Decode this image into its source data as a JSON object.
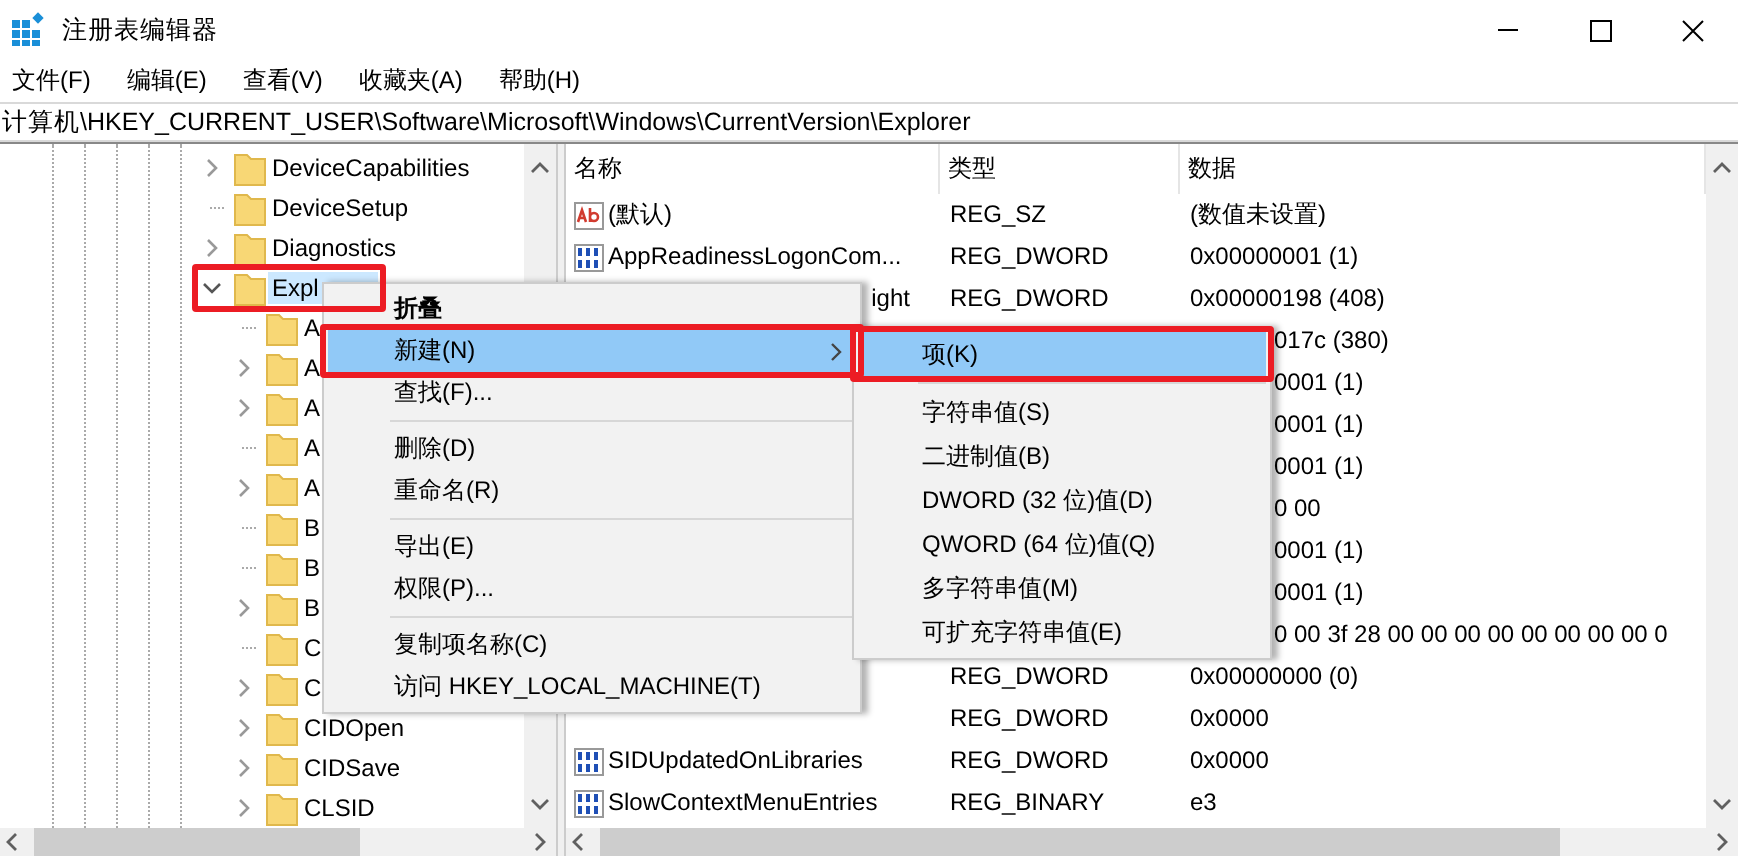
{
  "window": {
    "title": "注册表编辑器"
  },
  "menu_bar": [
    "文件(F)",
    "编辑(E)",
    "查看(V)",
    "收藏夹(A)",
    "帮助(H)"
  ],
  "address": "计算机\\HKEY_CURRENT_USER\\Software\\Microsoft\\Windows\\CurrentVersion\\Explorer",
  "tree": [
    {
      "label": "DeviceCapabilities",
      "expandable": true,
      "expanded": false,
      "selected": false,
      "highlighted": false
    },
    {
      "label": "DeviceSetup",
      "expandable": false,
      "selected": false,
      "highlighted": false
    },
    {
      "label": "Diagnostics",
      "expandable": true,
      "expanded": false,
      "selected": false,
      "highlighted": false
    },
    {
      "label": "Expl",
      "expandable": true,
      "expanded": true,
      "selected": true,
      "highlighted": true,
      "children": [
        {
          "label": "A",
          "expandable": false,
          "selected": false,
          "highlighted": false
        },
        {
          "label": "A",
          "expandable": true,
          "expanded": false,
          "selected": false,
          "highlighted": false
        },
        {
          "label": "A",
          "expandable": true,
          "expanded": false,
          "selected": false,
          "highlighted": false
        },
        {
          "label": "A",
          "expandable": false,
          "selected": false,
          "highlighted": false
        },
        {
          "label": "A",
          "expandable": true,
          "expanded": false,
          "selected": false,
          "highlighted": false
        },
        {
          "label": "B",
          "expandable": false,
          "selected": false,
          "highlighted": false
        },
        {
          "label": "B",
          "expandable": false,
          "selected": false,
          "highlighted": false
        },
        {
          "label": "B",
          "expandable": true,
          "expanded": false,
          "selected": false,
          "highlighted": false
        },
        {
          "label": "C",
          "expandable": false,
          "selected": false,
          "highlighted": false
        },
        {
          "label": "C",
          "expandable": true,
          "expanded": false,
          "selected": false,
          "highlighted": false
        },
        {
          "label": "CIDOpen",
          "expandable": true,
          "expanded": false,
          "selected": false,
          "highlighted": false
        },
        {
          "label": "CIDSave",
          "expandable": true,
          "expanded": false,
          "selected": false,
          "highlighted": false
        },
        {
          "label": "CLSID",
          "expandable": true,
          "expanded": false,
          "selected": false,
          "highlighted": false
        }
      ]
    }
  ],
  "values": {
    "columns": [
      "名称",
      "类型",
      "数据"
    ],
    "rows": [
      {
        "kind": "string_full",
        "name": "(默认)",
        "type": "REG_SZ",
        "data": "(数值未设置)"
      },
      {
        "kind": "number_full",
        "name": "AppReadinessLogonCom...",
        "type": "REG_DWORD",
        "data": "0x00000001 (1)"
      },
      {
        "kind": "name_tail",
        "name": "ight",
        "type": "REG_DWORD",
        "data": "0x00000198 (408)"
      },
      {
        "kind": "data_tail",
        "data": "017c (380)"
      },
      {
        "kind": "data_tail",
        "data": "0001 (1)"
      },
      {
        "kind": "data_tail",
        "data": "0001 (1)"
      },
      {
        "kind": "data_tail",
        "data": "0001 (1)"
      },
      {
        "kind": "data_tail",
        "data": "0 00"
      },
      {
        "kind": "data_tail",
        "data": "0001 (1)"
      },
      {
        "kind": "data_tail",
        "data": "0001 (1)"
      },
      {
        "kind": "data_tail",
        "data": "0 00 3f 28 00 00 00 00 00 00 00 00 0"
      },
      {
        "kind": "no_name",
        "type": "REG_DWORD",
        "data": "0x00000000 (0)"
      },
      {
        "kind": "no_name",
        "type": "REG_DWORD",
        "data": "0x0000"
      },
      {
        "kind": "number_full",
        "name": "SIDUpdatedOnLibraries",
        "type": "REG_DWORD",
        "data": "0x0000"
      },
      {
        "kind": "number_full",
        "name": "SlowContextMenuEntries",
        "type": "REG_BINARY",
        "data": "e3"
      }
    ]
  },
  "context_menu": [
    {
      "kind": "item",
      "label": "折叠",
      "bold": true,
      "selected": false,
      "submenu": false,
      "highlighted": false
    },
    {
      "kind": "item",
      "label": "新建(N)",
      "bold": false,
      "selected": true,
      "submenu": true,
      "highlighted": true
    },
    {
      "kind": "item",
      "label": "查找(F)...",
      "bold": false,
      "selected": false,
      "submenu": false,
      "highlighted": false
    },
    {
      "kind": "separator"
    },
    {
      "kind": "item",
      "label": "删除(D)",
      "bold": false,
      "selected": false,
      "submenu": false,
      "highlighted": false
    },
    {
      "kind": "item",
      "label": "重命名(R)",
      "bold": false,
      "selected": false,
      "submenu": false,
      "highlighted": false
    },
    {
      "kind": "separator"
    },
    {
      "kind": "item",
      "label": "导出(E)",
      "bold": false,
      "selected": false,
      "submenu": false,
      "highlighted": false
    },
    {
      "kind": "item",
      "label": "权限(P)...",
      "bold": false,
      "selected": false,
      "submenu": false,
      "highlighted": false
    },
    {
      "kind": "separator"
    },
    {
      "kind": "item",
      "label": "复制项名称(C)",
      "bold": false,
      "selected": false,
      "submenu": false,
      "highlighted": false
    },
    {
      "kind": "item",
      "label": "访问 HKEY_LOCAL_MACHINE(T)",
      "bold": false,
      "selected": false,
      "submenu": false,
      "highlighted": false
    }
  ],
  "submenu": [
    {
      "kind": "item",
      "label": "项(K)",
      "bold": false,
      "selected": true,
      "submenu": false,
      "highlighted": true
    },
    {
      "kind": "separator"
    },
    {
      "kind": "item",
      "label": "字符串值(S)",
      "bold": false,
      "selected": false,
      "submenu": false,
      "highlighted": false
    },
    {
      "kind": "item",
      "label": "二进制值(B)",
      "bold": false,
      "selected": false,
      "submenu": false,
      "highlighted": false
    },
    {
      "kind": "item",
      "label": "DWORD (32 位)值(D)",
      "bold": false,
      "selected": false,
      "submenu": false,
      "highlighted": false
    },
    {
      "kind": "item",
      "label": "QWORD (64 位)值(Q)",
      "bold": false,
      "selected": false,
      "submenu": false,
      "highlighted": false
    },
    {
      "kind": "item",
      "label": "多字符串值(M)",
      "bold": false,
      "selected": false,
      "submenu": false,
      "highlighted": false
    },
    {
      "kind": "item",
      "label": "可扩充字符串值(E)",
      "bold": false,
      "selected": false,
      "submenu": false,
      "highlighted": false
    }
  ]
}
